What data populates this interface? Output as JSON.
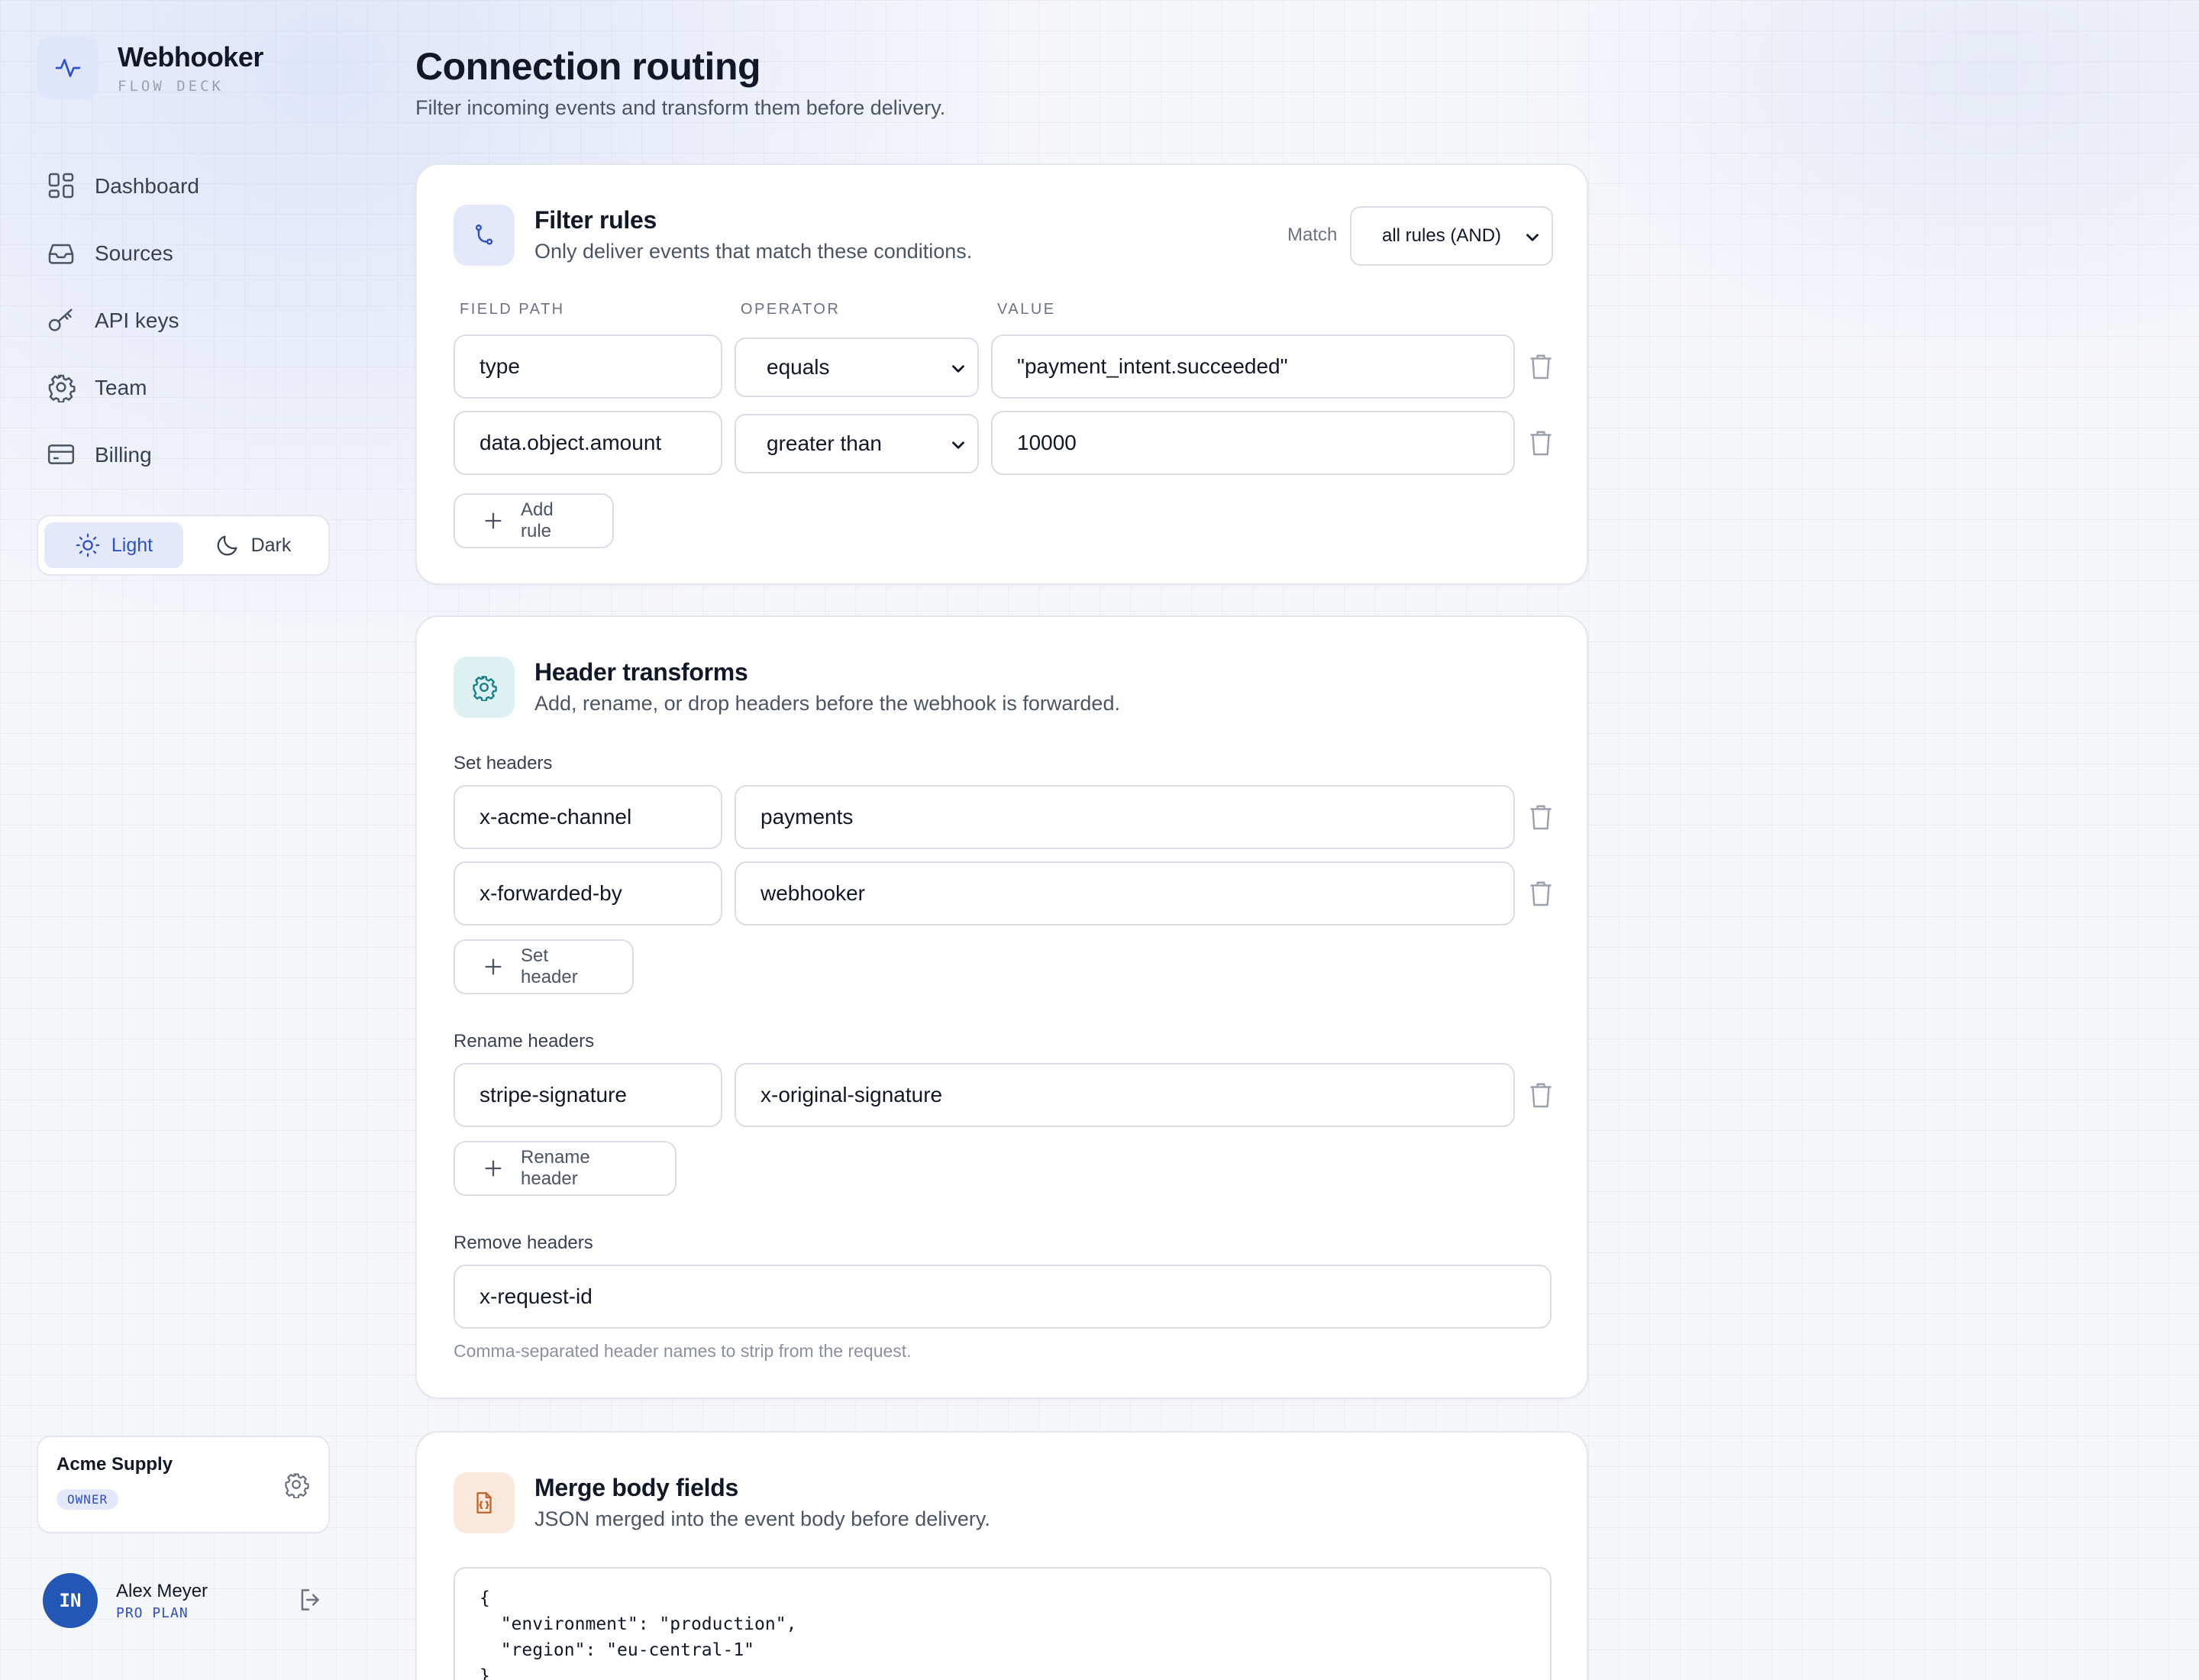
{
  "brand": {
    "name": "Webhooker",
    "subtitle": "FLOW DECK",
    "icon": "activity-icon",
    "accent": "#2d50c4"
  },
  "nav": [
    {
      "label": "Dashboard",
      "icon": "dashboard-icon"
    },
    {
      "label": "Sources",
      "icon": "inbox-icon"
    },
    {
      "label": "API keys",
      "icon": "key-icon"
    },
    {
      "label": "Team",
      "icon": "gear-icon"
    },
    {
      "label": "Billing",
      "icon": "credit-card-icon"
    }
  ],
  "theme": {
    "light_label": "Light",
    "dark_label": "Dark",
    "selected": "Light"
  },
  "org": {
    "name": "Acme Supply",
    "role": "OWNER"
  },
  "user": {
    "initials": "IN",
    "name": "Alex Meyer",
    "plan": "PRO PLAN"
  },
  "page": {
    "title": "Connection routing",
    "subtitle": "Filter incoming events and transform them before delivery."
  },
  "filter": {
    "title": "Filter rules",
    "subtitle": "Only deliver events that match these conditions.",
    "match_label": "Match",
    "match_value": "all rules (AND)",
    "columns": {
      "field": "FIELD PATH",
      "operator": "OPERATOR",
      "value": "VALUE"
    },
    "rules": [
      {
        "field": "type",
        "operator": "equals",
        "value": "\"payment_intent.succeeded\""
      },
      {
        "field": "data.object.amount",
        "operator": "greater than",
        "value": "10000"
      }
    ],
    "add_label": "Add rule"
  },
  "headers": {
    "title": "Header transforms",
    "subtitle": "Add, rename, or drop headers before the webhook is forwarded.",
    "set_label": "Set headers",
    "set": [
      {
        "name": "x-acme-channel",
        "value": "payments"
      },
      {
        "name": "x-forwarded-by",
        "value": "webhooker"
      }
    ],
    "set_button": "Set header",
    "rename_label": "Rename headers",
    "rename": [
      {
        "from": "stripe-signature",
        "to": "x-original-signature"
      }
    ],
    "rename_button": "Rename header",
    "remove_label": "Remove headers",
    "remove_value": "x-request-id",
    "remove_hint": "Comma-separated header names to strip from the request."
  },
  "merge": {
    "title": "Merge body fields",
    "subtitle": "JSON merged into the event body before delivery.",
    "json": "{\n  \"environment\": \"production\",\n  \"region\": \"eu-central-1\"\n}"
  }
}
